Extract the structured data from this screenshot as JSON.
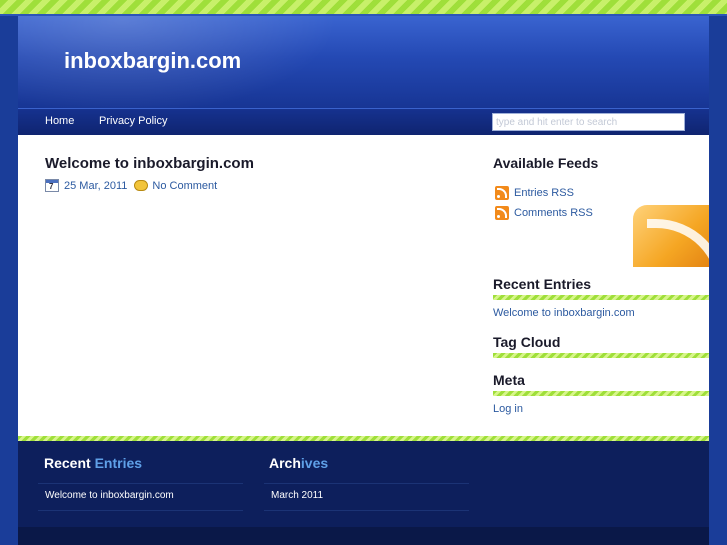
{
  "header": {
    "site_title": "inboxbargin.com"
  },
  "nav": {
    "items": [
      {
        "label": "Home"
      },
      {
        "label": "Privacy Policy"
      }
    ],
    "search_placeholder": "type and hit enter to search"
  },
  "post": {
    "title": "Welcome to inboxbargin.com",
    "calendar_day": "7",
    "date": "25 Mar, 2011",
    "comments": "No Comment"
  },
  "sidebar": {
    "feeds": {
      "heading": "Available Feeds",
      "entries_rss": "Entries RSS",
      "comments_rss": "Comments RSS"
    },
    "recent": {
      "heading": "Recent Entries",
      "items": [
        "Welcome to inboxbargin.com"
      ]
    },
    "tags": {
      "heading": "Tag Cloud"
    },
    "meta": {
      "heading": "Meta",
      "items": [
        "Log in"
      ]
    }
  },
  "footer": {
    "recent": {
      "heading_part1": "Recent ",
      "heading_part2": "Entries",
      "items": [
        "Welcome to inboxbargin.com"
      ]
    },
    "archives": {
      "heading_part1": "Arch",
      "heading_part2": "ives",
      "items": [
        "March 2011"
      ]
    }
  },
  "colors": {
    "link": "#2c5aa0",
    "accent_green": "#9fdf3a",
    "footer_bg": "#0d1f5c"
  }
}
